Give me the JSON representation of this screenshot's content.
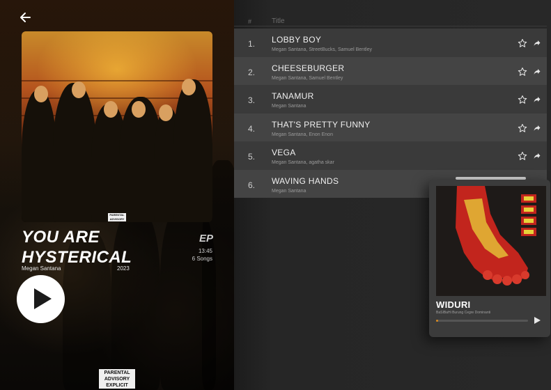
{
  "album": {
    "title": "YOU ARE HYSTERICAL",
    "artist": "Megan Santana",
    "year": "2023",
    "type": "EP",
    "duration": "13:45",
    "song_count": "6 Songs",
    "advisory_small": "PARENTAL ADVISORY",
    "advisory_bottom": "PARENTAL ADVISORY EXPLICIT CONTENT"
  },
  "tracklist": {
    "header_num": "#",
    "header_title": "Title",
    "tracks": [
      {
        "num": "1.",
        "title": "LOBBY BOY",
        "artists": "Megan Santana, StreetBucks, Samuel Bentley"
      },
      {
        "num": "2.",
        "title": "CHEESEBURGER",
        "artists": "Megan Santana, Samuel Bentley"
      },
      {
        "num": "3.",
        "title": "TANAMUR",
        "artists": "Megan Santana"
      },
      {
        "num": "4.",
        "title": "THAT'S PRETTY FUNNY",
        "artists": "Megan Santana, Enon Enon"
      },
      {
        "num": "5.",
        "title": "VEGA",
        "artists": "Megan Santana, agatha skar"
      },
      {
        "num": "6.",
        "title": "WAVING HANDS",
        "artists": "Megan Santana"
      }
    ]
  },
  "now_playing": {
    "title": "WIDURI",
    "artists": "BaSIBaHi Burung Cegre Dominanti",
    "progress": 0.02
  },
  "icons": {
    "back": "arrow-left-icon",
    "favorite": "star-outline-icon",
    "share": "share-arrow-icon",
    "play": "play-icon"
  },
  "colors": {
    "accent": "#d98a1e",
    "background": "#262626"
  }
}
